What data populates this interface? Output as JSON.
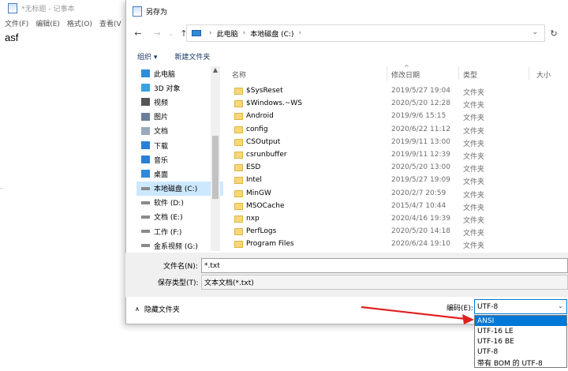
{
  "notepad": {
    "title": "*无标题 - 记事本",
    "menu": [
      "文件(F)",
      "编辑(E)",
      "格式(O)",
      "查看(V"
    ],
    "content": "asf"
  },
  "dialog": {
    "title": "另存为",
    "breadcrumb": [
      "此电脑",
      "本地磁盘 (C:)"
    ],
    "toolbar": {
      "organize": "组织 ▾",
      "new_folder": "新建文件夹"
    },
    "nav_items": [
      {
        "label": "此电脑",
        "icon": "computer-icon"
      },
      {
        "label": "3D 对象",
        "icon": "3d-objects-icon"
      },
      {
        "label": "视频",
        "icon": "video-icon"
      },
      {
        "label": "图片",
        "icon": "pictures-icon"
      },
      {
        "label": "文档",
        "icon": "documents-icon"
      },
      {
        "label": "下载",
        "icon": "download-icon"
      },
      {
        "label": "音乐",
        "icon": "music-icon"
      },
      {
        "label": "桌面",
        "icon": "desktop-icon"
      },
      {
        "label": "本地磁盘 (C:)",
        "icon": "drive-icon",
        "selected": true
      },
      {
        "label": "软件 (D:)",
        "icon": "drive-icon"
      },
      {
        "label": "文档 (E:)",
        "icon": "drive-icon"
      },
      {
        "label": "工作 (F:)",
        "icon": "drive-icon"
      },
      {
        "label": "金系视频 (G:)",
        "icon": "drive-icon"
      }
    ],
    "columns": {
      "name": "名称",
      "date": "修改日期",
      "type": "类型",
      "size": "大小"
    },
    "files": [
      {
        "name": "$SysReset",
        "date": "2019/5/27 19:04",
        "type": "文件夹"
      },
      {
        "name": "$Windows.~WS",
        "date": "2020/5/20 12:28",
        "type": "文件夹"
      },
      {
        "name": "Android",
        "date": "2019/9/6 15:15",
        "type": "文件夹"
      },
      {
        "name": "config",
        "date": "2020/6/22 11:12",
        "type": "文件夹"
      },
      {
        "name": "CSOutput",
        "date": "2019/9/11 13:00",
        "type": "文件夹"
      },
      {
        "name": "csrunbuffer",
        "date": "2019/9/11 12:39",
        "type": "文件夹"
      },
      {
        "name": "ESD",
        "date": "2020/5/20 13:00",
        "type": "文件夹"
      },
      {
        "name": "Intel",
        "date": "2019/5/27 19:09",
        "type": "文件夹"
      },
      {
        "name": "MinGW",
        "date": "2020/2/7 20:59",
        "type": "文件夹"
      },
      {
        "name": "MSOCache",
        "date": "2015/4/7 10:44",
        "type": "文件夹"
      },
      {
        "name": "nxp",
        "date": "2020/4/16 19:39",
        "type": "文件夹"
      },
      {
        "name": "PerfLogs",
        "date": "2020/5/20 14:18",
        "type": "文件夹"
      },
      {
        "name": "Program Files",
        "date": "2020/6/24 19:10",
        "type": "文件夹"
      }
    ],
    "filename_label": "文件名(N):",
    "filename_value": "*.txt",
    "filetype_label": "保存类型(T):",
    "filetype_value": "文本文档(*.txt)",
    "hide_folders": "隐藏文件夹",
    "encoding_label": "编码(E):",
    "encoding_value": "UTF-8",
    "encoding_options": [
      {
        "label": "ANSI",
        "highlighted": true
      },
      {
        "label": "UTF-16 LE"
      },
      {
        "label": "UTF-16 BE"
      },
      {
        "label": "UTF-8"
      },
      {
        "label": "带有 BOM 的 UTF-8"
      }
    ]
  },
  "colors": {
    "accent": "#0078d7",
    "selection": "#cce8ff",
    "folder": "#f8d775",
    "arrow": "#e02020"
  }
}
